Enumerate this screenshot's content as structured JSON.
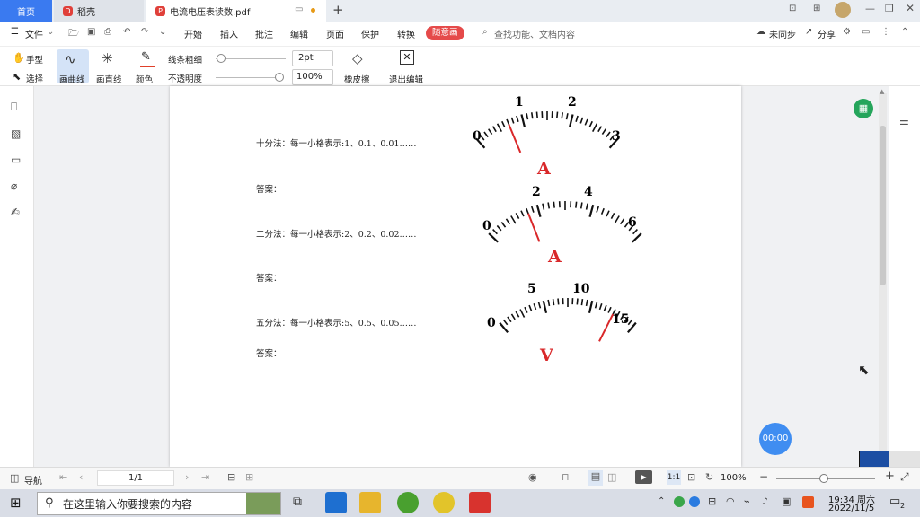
{
  "tabs": {
    "home": "首页",
    "daoke": "稻壳",
    "pdf": "电流电压表读数.pdf"
  },
  "menu": {
    "file": "文件",
    "items": [
      "开始",
      "插入",
      "批注",
      "编辑",
      "页面",
      "保护",
      "转换"
    ],
    "active": "随意画",
    "search_placeholder": "查找功能、文档内容",
    "sync": "未同步",
    "share": "分享"
  },
  "toolbar": {
    "hand": "手型",
    "select": "选择",
    "curve": "画曲线",
    "line": "画直线",
    "color": "颜色",
    "stroke_label": "线条粗细",
    "stroke_value": "2pt",
    "opacity_label": "不透明度",
    "opacity_value": "100%",
    "eraser": "橡皮擦",
    "exit": "退出编辑"
  },
  "document": {
    "q1": "十分法：每一小格表示:1、0.1、0.01……",
    "a1": "答案：",
    "q2": "二分法：每一小格表示:2、0.2、0.02……",
    "a2": "答案：",
    "q3": "五分法：每一小格表示:5、0.5、0.05……",
    "a3": "答案："
  },
  "meters": [
    {
      "ticks": [
        "0",
        "1",
        "2",
        "3"
      ],
      "unit": "A",
      "divisions": 30,
      "needle_value": 0.7,
      "max": 3
    },
    {
      "ticks": [
        "0",
        "2",
        "4",
        "6"
      ],
      "unit": "A",
      "divisions": 30,
      "needle_value": 1.6,
      "max": 6
    },
    {
      "ticks": [
        "0",
        "5",
        "10",
        "15"
      ],
      "unit": "V",
      "divisions": 30,
      "needle_value": 12.5,
      "max": 15
    }
  ],
  "timer": "00:00",
  "statusbar": {
    "nav": "导航",
    "page": "1/1",
    "zoom": "100%"
  },
  "taskbar": {
    "search_placeholder": "在这里输入你要搜索的内容",
    "time": "19:34 周六",
    "date": "2022/11/5",
    "notifications": "2"
  }
}
